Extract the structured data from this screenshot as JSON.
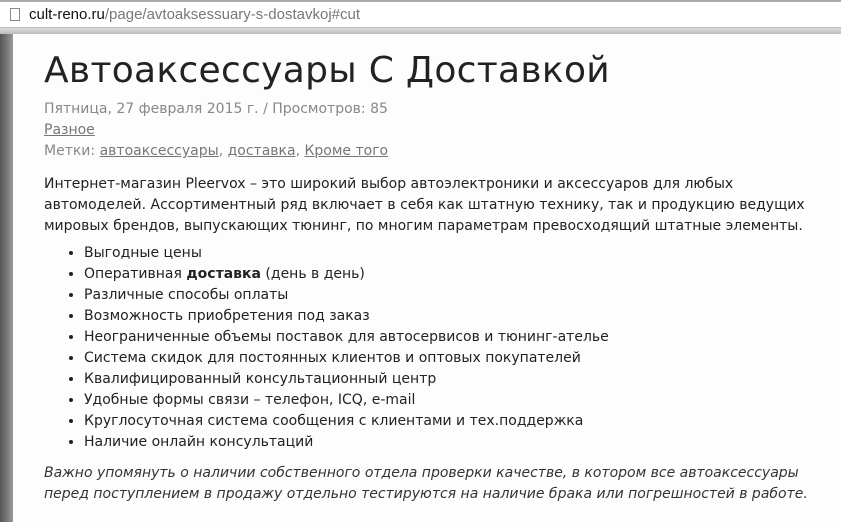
{
  "browser": {
    "url_domain": "cult-reno.ru",
    "url_path": "/page/avtoaksessuary-s-dostavkoj#cut"
  },
  "article": {
    "title": "Автоаксессуары С Доставкой",
    "meta": "Пятница, 27 февраля 2015 г. / Просмотров: 85",
    "category": "Разное",
    "tags_label": "Метки:",
    "tags": [
      "автоаксессуары",
      "доставка",
      "Кроме того"
    ],
    "intro": "Интернет-магазин Pleervox – это широкий выбор автоэлектроники и аксессуаров для любых автомоделей. Ассортиментный ряд включает в себя как штатную технику, так и продукцию ведущих мировых брендов, выпускающих тюнинг, по многим параметрам превосходящий штатные элементы.",
    "list": [
      "Выгодные цены",
      "Оперативная",
      "доставка",
      "(день в день)",
      "Различные способы оплаты",
      "Возможность приобретения под заказ",
      "Неограниченные объемы поставок для автосервисов и тюнинг-ателье",
      "Система скидок для постоянных клиентов и оптовых покупателей",
      "Квалифицированный консультационный центр",
      "Удобные формы связи – телефон, ICQ, e-mail",
      "Круглосуточная система сообщения с клиентами и тех.поддержка",
      "Наличие онлайн консультаций"
    ],
    "note": "Важно упомянуть о наличии собственного отдела проверки качестве, в котором все автоаксессуары перед поступлением в продажу отдельно тестируются на наличие брака или погрешностей в работе."
  }
}
